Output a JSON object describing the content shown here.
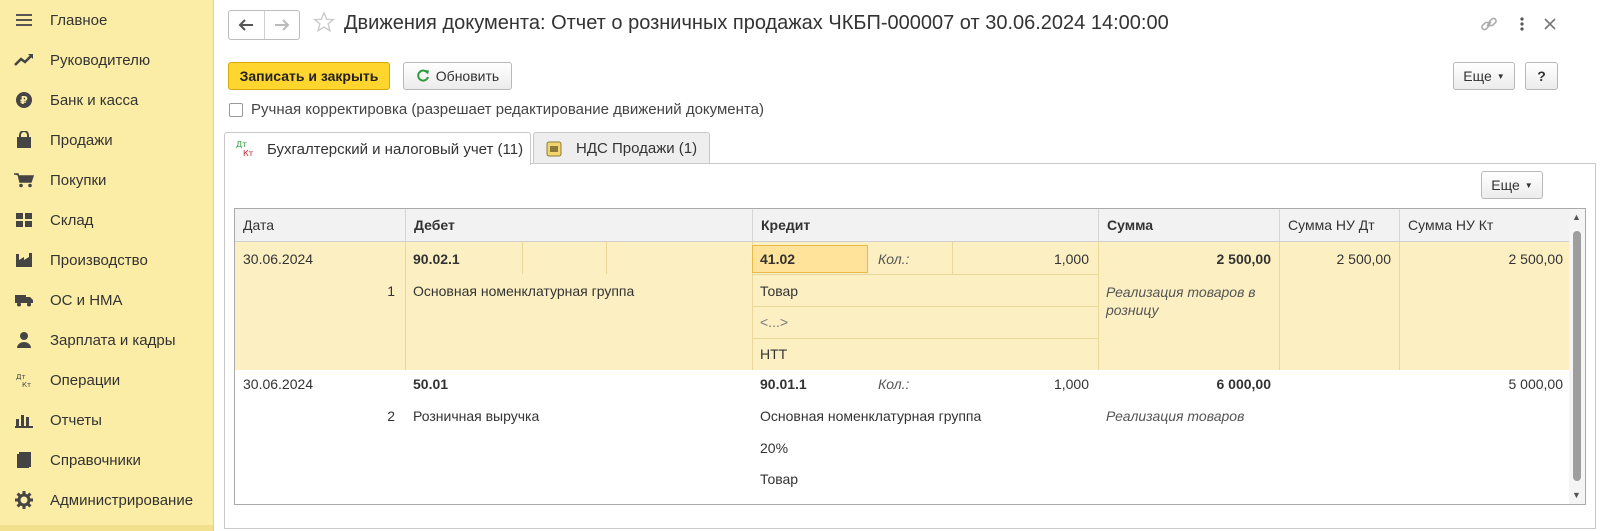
{
  "sidebar": {
    "items": [
      {
        "label": "Главное",
        "icon": "hamburger-icon"
      },
      {
        "label": "Руководителю",
        "icon": "trend-icon"
      },
      {
        "label": "Банк и касса",
        "icon": "ruble-icon"
      },
      {
        "label": "Продажи",
        "icon": "bag-icon"
      },
      {
        "label": "Покупки",
        "icon": "cart-icon"
      },
      {
        "label": "Склад",
        "icon": "warehouse-icon"
      },
      {
        "label": "Производство",
        "icon": "factory-icon"
      },
      {
        "label": "ОС и НМА",
        "icon": "truck-icon"
      },
      {
        "label": "Зарплата и кадры",
        "icon": "person-icon"
      },
      {
        "label": "Операции",
        "icon": "dt-kt-icon"
      },
      {
        "label": "Отчеты",
        "icon": "bar-chart-icon"
      },
      {
        "label": "Справочники",
        "icon": "book-icon"
      },
      {
        "label": "Администрирование",
        "icon": "gear-icon"
      }
    ]
  },
  "header": {
    "title": "Движения документа: Отчет о розничных продажах ЧКБП-000007 от 30.06.2024 14:00:00"
  },
  "toolbar": {
    "save_close_label": "Записать и закрыть",
    "refresh_label": "Обновить",
    "more_label": "Еще",
    "help_label": "?"
  },
  "manual_edit": {
    "label": "Ручная корректировка (разрешает редактирование движений документа)",
    "checked": false
  },
  "tabs": [
    {
      "label": "Бухгалтерский и налоговый учет (11)",
      "icon": "dt-kt-icon",
      "active": true
    },
    {
      "label": "НДС Продажи (1)",
      "icon": "register-icon",
      "active": false
    }
  ],
  "panel": {
    "more_label": "Еще"
  },
  "table": {
    "columns": [
      "Дата",
      "Дебет",
      "Кредит",
      "Сумма",
      "Сумма НУ Дт",
      "Сумма НУ Кт"
    ],
    "rows": [
      {
        "date": "30.06.2024",
        "num": "1",
        "debit_account": "90.02.1",
        "debit_sub": "Основная номенклатурная группа",
        "credit_account": "41.02",
        "qty_label": "Кол.:",
        "qty": "1,000",
        "credit_sub1": "Товар",
        "credit_sub2": "<...>",
        "credit_sub3": "НТТ",
        "amount": "2 500,00",
        "content": "Реализация товаров в розницу",
        "nu_dt": "2 500,00",
        "nu_kt": "2 500,00"
      },
      {
        "date": "30.06.2024",
        "num": "2",
        "debit_account": "50.01",
        "debit_sub": "Розничная выручка",
        "credit_account": "90.01.1",
        "qty_label": "Кол.:",
        "qty": "1,000",
        "credit_sub1": "Основная номенклатурная группа",
        "credit_sub2": "20%",
        "credit_sub3": "Товар",
        "amount": "6 000,00",
        "content": "Реализация товаров",
        "nu_dt": "",
        "nu_kt": "5 000,00"
      }
    ]
  },
  "colors": {
    "sidebar_bg": "#fbeda5",
    "primary_button": "#ffd52e",
    "selected_row": "#fcf0c3"
  }
}
